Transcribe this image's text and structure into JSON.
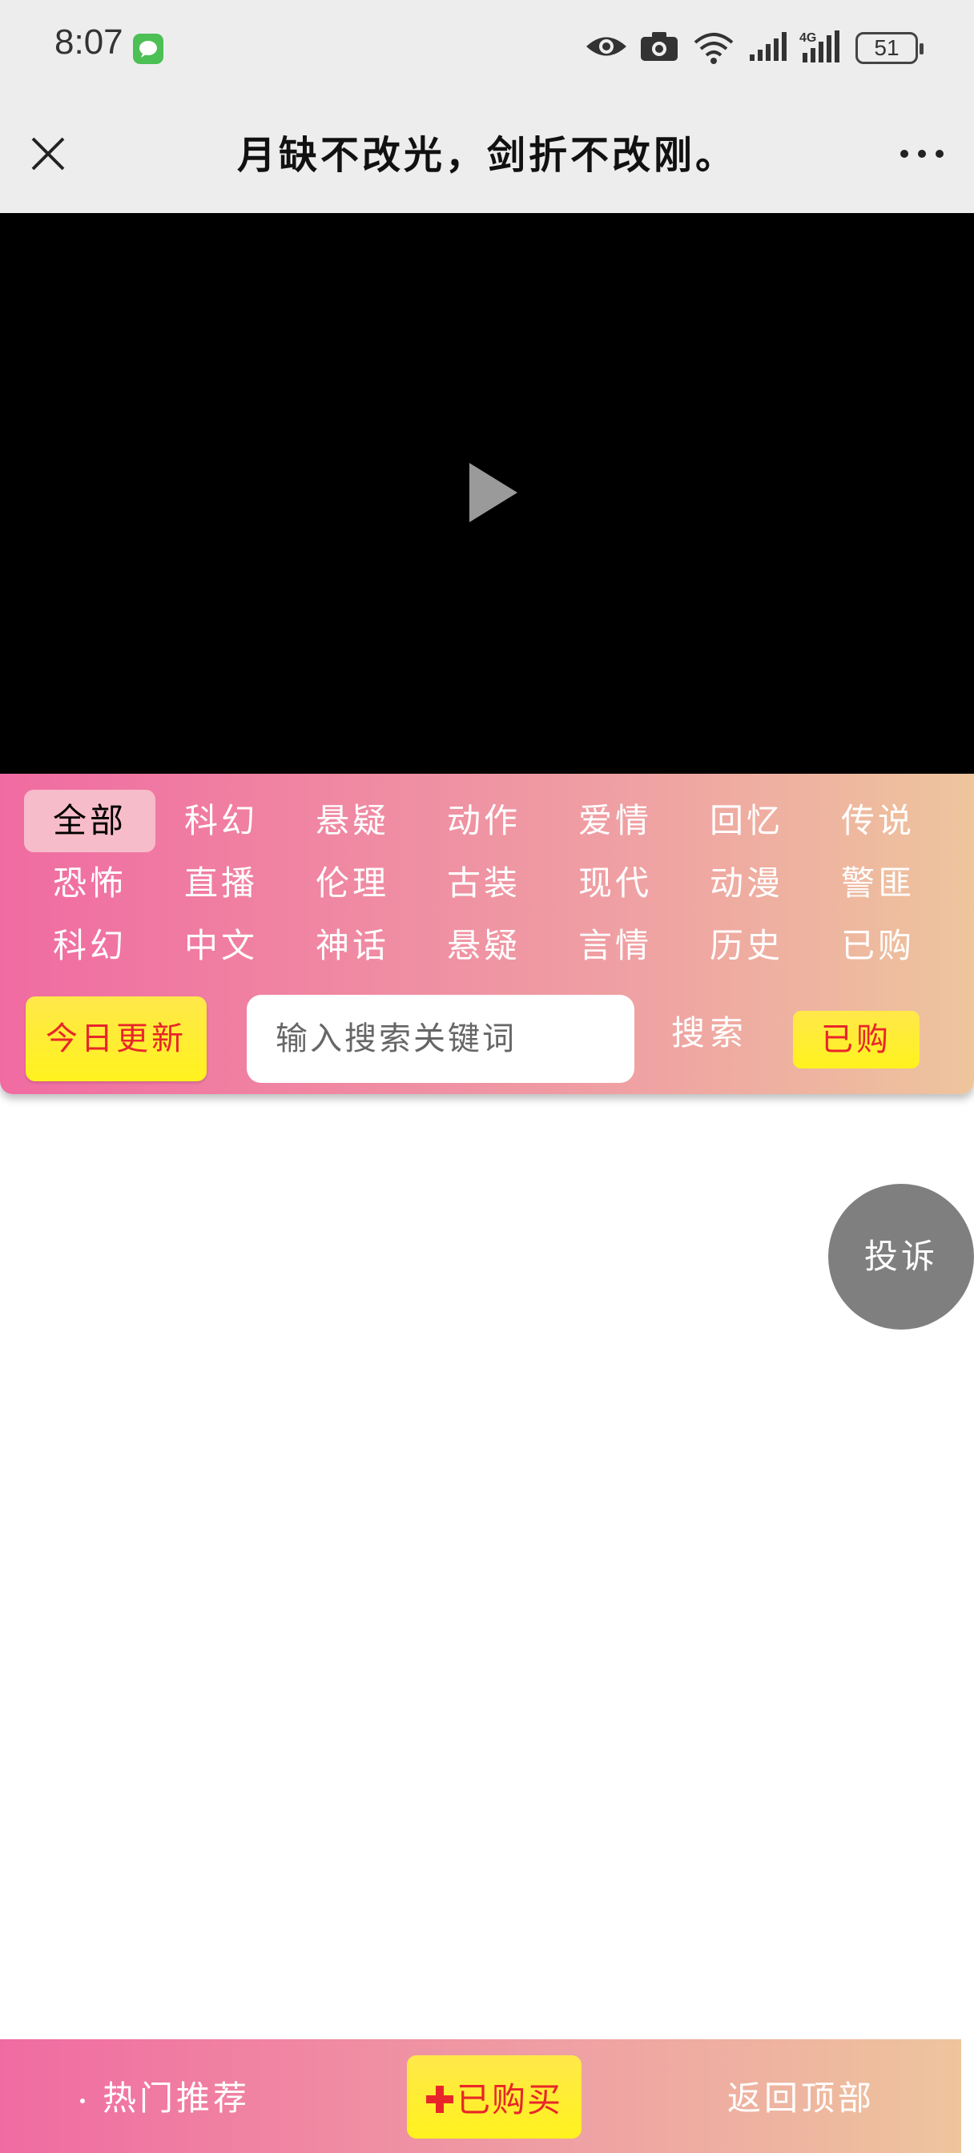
{
  "status_bar": {
    "time": "8:07",
    "battery": "51",
    "icons": [
      "wechat-icon",
      "eye-icon",
      "camera-icon",
      "wifi-icon",
      "signal-icon",
      "4g-signal-icon",
      "battery-icon"
    ]
  },
  "header": {
    "title": "月缺不改光，剑折不改刚。",
    "close_icon": "close-icon",
    "more_icon": "more-icon"
  },
  "video": {
    "play_icon": "play-icon"
  },
  "categories": [
    "全部",
    "科幻",
    "悬疑",
    "动作",
    "爱情",
    "回忆",
    "传说",
    "恐怖",
    "直播",
    "伦理",
    "古装",
    "现代",
    "动漫",
    "警匪",
    "科幻",
    "中文",
    "神话",
    "悬疑",
    "言情",
    "历史",
    "已购"
  ],
  "active_category": "全部",
  "toolbar": {
    "today_label": "今日更新",
    "search_placeholder": "输入搜索关键词",
    "search_label": "搜索",
    "bought_label": "已购"
  },
  "complain_label": "投诉",
  "bottom_bar": {
    "hot_label": "热门推荐",
    "bought_label": "已购买",
    "back_top_label": "返回顶部"
  },
  "colors": {
    "gradient_start": "#f06ba2",
    "gradient_end": "#eec59d",
    "yellow_button": "#fff21e",
    "red_text": "#e8262a"
  }
}
